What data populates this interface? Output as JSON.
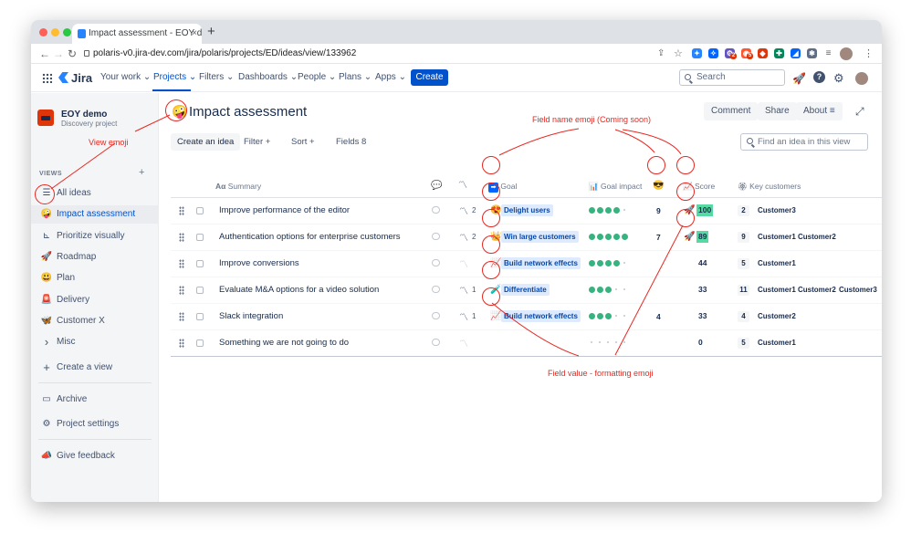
{
  "browser": {
    "tab_title": "Impact assessment - EOY demo",
    "tab_close": "×",
    "new_tab": "+",
    "url": "polaris-v0.jira-dev.com/jira/polaris/projects/ED/ideas/view/133962",
    "back": "←",
    "forward": "→",
    "reload": "↻",
    "traffic_colors": [
      "#ff5f57",
      "#febc2e",
      "#28c840"
    ],
    "extension_badges": [
      "2",
      "5"
    ]
  },
  "topnav": {
    "logo_text": "Jira",
    "items": [
      "Your work ⌄",
      "Projects ⌄",
      "Filters ⌄",
      "Dashboards ⌄",
      "People ⌄",
      "Plans ⌄",
      "Apps ⌄"
    ],
    "create": "Create",
    "search_placeholder": "Search",
    "help": "?",
    "notification_icon": "rocket-icon",
    "settings_icon": "gear-icon",
    "accent": "#0052cc"
  },
  "sidebar": {
    "project_name": "EOY demo",
    "project_type": "Discovery project",
    "views_heading": "VIEWS",
    "views_add": "+",
    "items": [
      {
        "icon": "☰",
        "icon_name": "list-icon",
        "label": "All ideas"
      },
      {
        "icon": "🤪",
        "icon_name": "zany-face-icon",
        "label": "Impact assessment"
      },
      {
        "icon": "⊾",
        "icon_name": "matrix-icon",
        "label": "Prioritize visually"
      },
      {
        "icon": "🚀",
        "icon_name": "rocket-icon",
        "label": "Roadmap"
      },
      {
        "icon": "😃",
        "icon_name": "smiley-icon",
        "label": "Plan"
      },
      {
        "icon": "🚨",
        "icon_name": "siren-icon",
        "label": "Delivery"
      },
      {
        "icon": "🦋",
        "icon_name": "butterfly-icon",
        "label": "Customer X"
      },
      {
        "icon": "›",
        "icon_name": "chevron-right-icon",
        "label": "Misc"
      },
      {
        "icon": "+",
        "icon_name": "plus-icon",
        "label": "Create a view"
      }
    ],
    "footer_items": [
      {
        "icon": "▭",
        "icon_name": "archive-icon",
        "label": "Archive"
      },
      {
        "icon": "⚙",
        "icon_name": "gear-icon",
        "label": "Project settings"
      }
    ],
    "feedback": {
      "icon": "📣",
      "icon_name": "megaphone-icon",
      "label": "Give feedback"
    }
  },
  "header": {
    "emoji": "🤪",
    "title": "Impact assessment",
    "comment": "Comment",
    "share": "Share",
    "about": "About",
    "about_icon": "≡",
    "expand_icon": "⤢"
  },
  "toolbar": {
    "create_idea": "Create an idea",
    "filter": "Filter +",
    "sort": "Sort +",
    "fields": "Fields 8",
    "find_placeholder": "Find an idea in this view"
  },
  "columns": {
    "summary_prefix": "Aα",
    "summary": "Summary",
    "goal_icon": "➡",
    "goal": "Goal",
    "goal_impact_icon": "📊",
    "goal_impact": "Goal impact",
    "cool_emoji": "😎",
    "score_emoji": "📈",
    "score": "Score",
    "customers_icon": "🏵",
    "customers": "Key customers",
    "insights_icon": "〽",
    "comments_icon": "comment-icon"
  },
  "rows": [
    {
      "summary": "Improve performance of the editor",
      "insights": "2",
      "goal_emoji": "😍",
      "goal": "Delight users",
      "impact": 4,
      "cool": "9",
      "score_emoji": "🚀",
      "score": "100",
      "score_highlight": true,
      "cust_count": "2",
      "customers": [
        "Customer3"
      ]
    },
    {
      "summary": "Authentication options for enterprise customers",
      "insights": "2",
      "goal_emoji": "👑",
      "goal": "Win large customers",
      "impact": 5,
      "cool": "7",
      "score_emoji": "🚀",
      "score": "89",
      "score_highlight": true,
      "cust_count": "9",
      "customers": [
        "Customer1",
        "Customer2"
      ]
    },
    {
      "summary": "Improve conversions",
      "insights": "",
      "goal_emoji": "📈",
      "goal": "Build network effects",
      "impact": 4,
      "cool": "",
      "score_emoji": "",
      "score": "44",
      "score_highlight": false,
      "cust_count": "5",
      "customers": [
        "Customer1"
      ]
    },
    {
      "summary": "Evaluate M&A options for a video solution",
      "insights": "1",
      "goal_emoji": "🧪",
      "goal": "Differentiate",
      "impact": 3,
      "cool": "",
      "score_emoji": "",
      "score": "33",
      "score_highlight": false,
      "cust_count": "11",
      "customers": [
        "Customer1",
        "Customer2",
        "Customer3"
      ]
    },
    {
      "summary": "Slack integration",
      "insights": "1",
      "goal_emoji": "📈",
      "goal": "Build network effects",
      "impact": 3,
      "cool": "4",
      "score_emoji": "",
      "score": "33",
      "score_highlight": false,
      "cust_count": "4",
      "customers": [
        "Customer2"
      ]
    },
    {
      "summary": "Something we are not going to do",
      "insights": "",
      "goal_emoji": "",
      "goal": "",
      "impact": 0,
      "cool": "",
      "score_emoji": "",
      "score": "0",
      "score_highlight": false,
      "cust_count": "5",
      "customers": [
        "Customer1"
      ]
    }
  ],
  "annotations": {
    "view_emoji": "View emoji",
    "field_name_emoji": "Field name emoji (Coming soon)",
    "field_value_emoji": "Field value - formatting emoji",
    "color": "#e8261f"
  }
}
